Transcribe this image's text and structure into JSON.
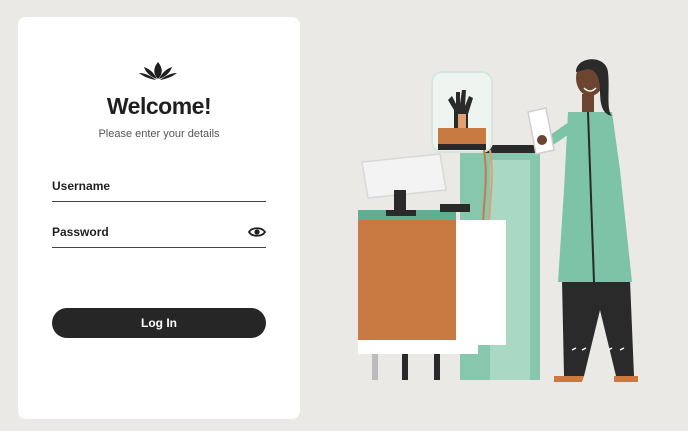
{
  "login": {
    "title": "Welcome!",
    "subtitle": "Please enter your details",
    "username_placeholder": "Username",
    "password_placeholder": "Password",
    "login_label": "Log In"
  },
  "icons": {
    "logo": "lotus-icon",
    "password_toggle": "eye-icon"
  },
  "colors": {
    "background": "#ebe9e6",
    "card": "#ffffff",
    "button": "#262626",
    "button_text": "#ffffff",
    "text": "#1f1f1f",
    "accent_teal": "#7cc3a8",
    "accent_orange": "#c97a43"
  }
}
